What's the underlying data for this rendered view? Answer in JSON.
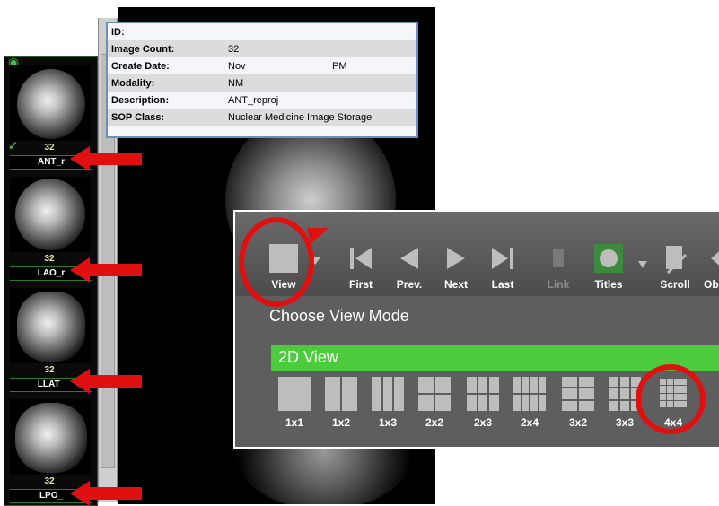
{
  "info_box": {
    "rows": [
      {
        "key": "ID:",
        "value": ""
      },
      {
        "key": "Image Count:",
        "value": "32"
      },
      {
        "key": "Create Date:",
        "value": "Nov",
        "value_suffix": "PM"
      },
      {
        "key": "Modality:",
        "value": "NM"
      },
      {
        "key": "Description:",
        "value": "ANT_reproj"
      },
      {
        "key": "SOP Class:",
        "value": "Nuclear Medicine Image Storage"
      }
    ]
  },
  "series": [
    {
      "count": "32",
      "name": "ANT_r"
    },
    {
      "count": "32",
      "name": "LAO_r"
    },
    {
      "count": "32",
      "name": "LLAT_"
    },
    {
      "count": "32",
      "name": "LPO_"
    }
  ],
  "toolbar": {
    "view_label": "View",
    "first_label": "First",
    "prev_label": "Prev.",
    "next_label": "Next",
    "last_label": "Last",
    "link_label": "Link",
    "titles_label": "Titles",
    "scroll_label": "Scroll",
    "obl_label": "Obl"
  },
  "view_mode": {
    "title": "Choose View Mode",
    "section": "2D View",
    "layouts": [
      "1x1",
      "1x2",
      "1x3",
      "2x2",
      "2x3",
      "2x4",
      "3x2",
      "3x3",
      "4x4"
    ]
  },
  "colors": {
    "highlight_red": "#e01010",
    "section_green": "#4ccc3c",
    "info_border": "#6e8fb8"
  }
}
